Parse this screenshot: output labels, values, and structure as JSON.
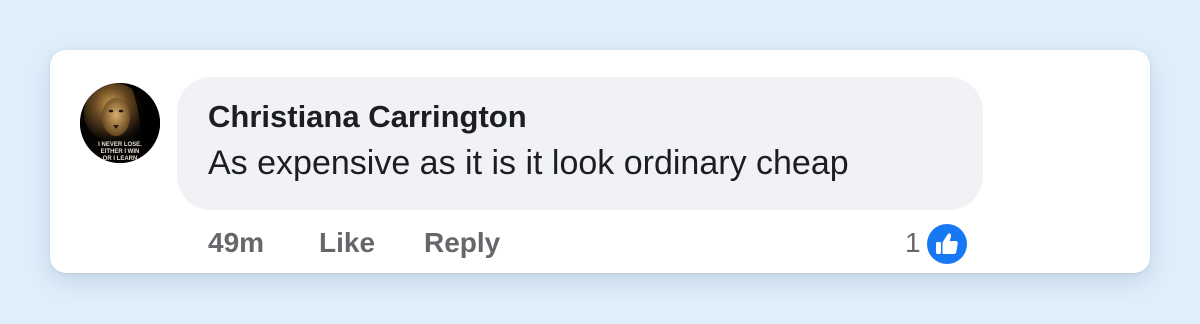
{
  "comment": {
    "author": "Christiana Carrington",
    "text": "As expensive as it is it look ordinary cheap",
    "avatar_text": [
      "I NEVER LOSE.",
      "EITHER I WIN",
      "OR I LEARN"
    ]
  },
  "actions": {
    "time": "49m",
    "like_label": "Like",
    "reply_label": "Reply"
  },
  "reactions": {
    "count": "1",
    "icon": "thumbs-up-icon"
  },
  "colors": {
    "page_background": "#dfeefb",
    "card_background": "#ffffff",
    "bubble_background": "#f0f2f5",
    "text_primary": "#1c1e21",
    "text_secondary": "#65676b",
    "like_blue": "#1877f2"
  }
}
